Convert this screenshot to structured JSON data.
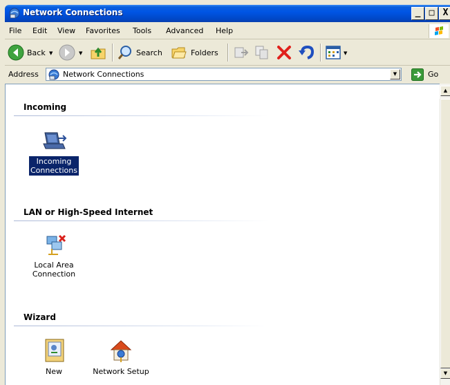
{
  "window": {
    "title": "Network Connections",
    "controls": {
      "minimize": "_",
      "maximize": "□",
      "close": "X"
    }
  },
  "menu": {
    "items": [
      "File",
      "Edit",
      "View",
      "Favorites",
      "Tools",
      "Advanced",
      "Help"
    ]
  },
  "toolbar": {
    "back_label": "Back",
    "search_label": "Search",
    "folders_label": "Folders",
    "icons": [
      "back-icon",
      "forward-icon",
      "up-folder-icon",
      "search-icon",
      "folders-icon",
      "move-to-icon",
      "copy-to-icon",
      "delete-icon",
      "undo-icon",
      "views-icon"
    ]
  },
  "address": {
    "label": "Address",
    "value": "Network Connections",
    "go_label": "Go"
  },
  "groups": [
    {
      "heading": "Incoming",
      "items": [
        {
          "label_line1": "Incoming",
          "label_line2": "Connections",
          "icon": "incoming-connections-icon",
          "selected": true
        }
      ]
    },
    {
      "heading": "LAN or High-Speed Internet",
      "items": [
        {
          "label_line1": "Local Area",
          "label_line2": "Connection",
          "icon": "local-area-connection-disconnected-icon",
          "selected": false
        }
      ]
    },
    {
      "heading": "Wizard",
      "items": [
        {
          "label_line1": "New",
          "icon": "new-connection-wizard-icon",
          "selected": false
        },
        {
          "label_line1": "Network Setup",
          "icon": "network-setup-wizard-icon",
          "selected": false
        }
      ]
    }
  ],
  "colors": {
    "titlebar": "#0055e5",
    "selection": "#0a246a",
    "window_face": "#ece9d8"
  }
}
